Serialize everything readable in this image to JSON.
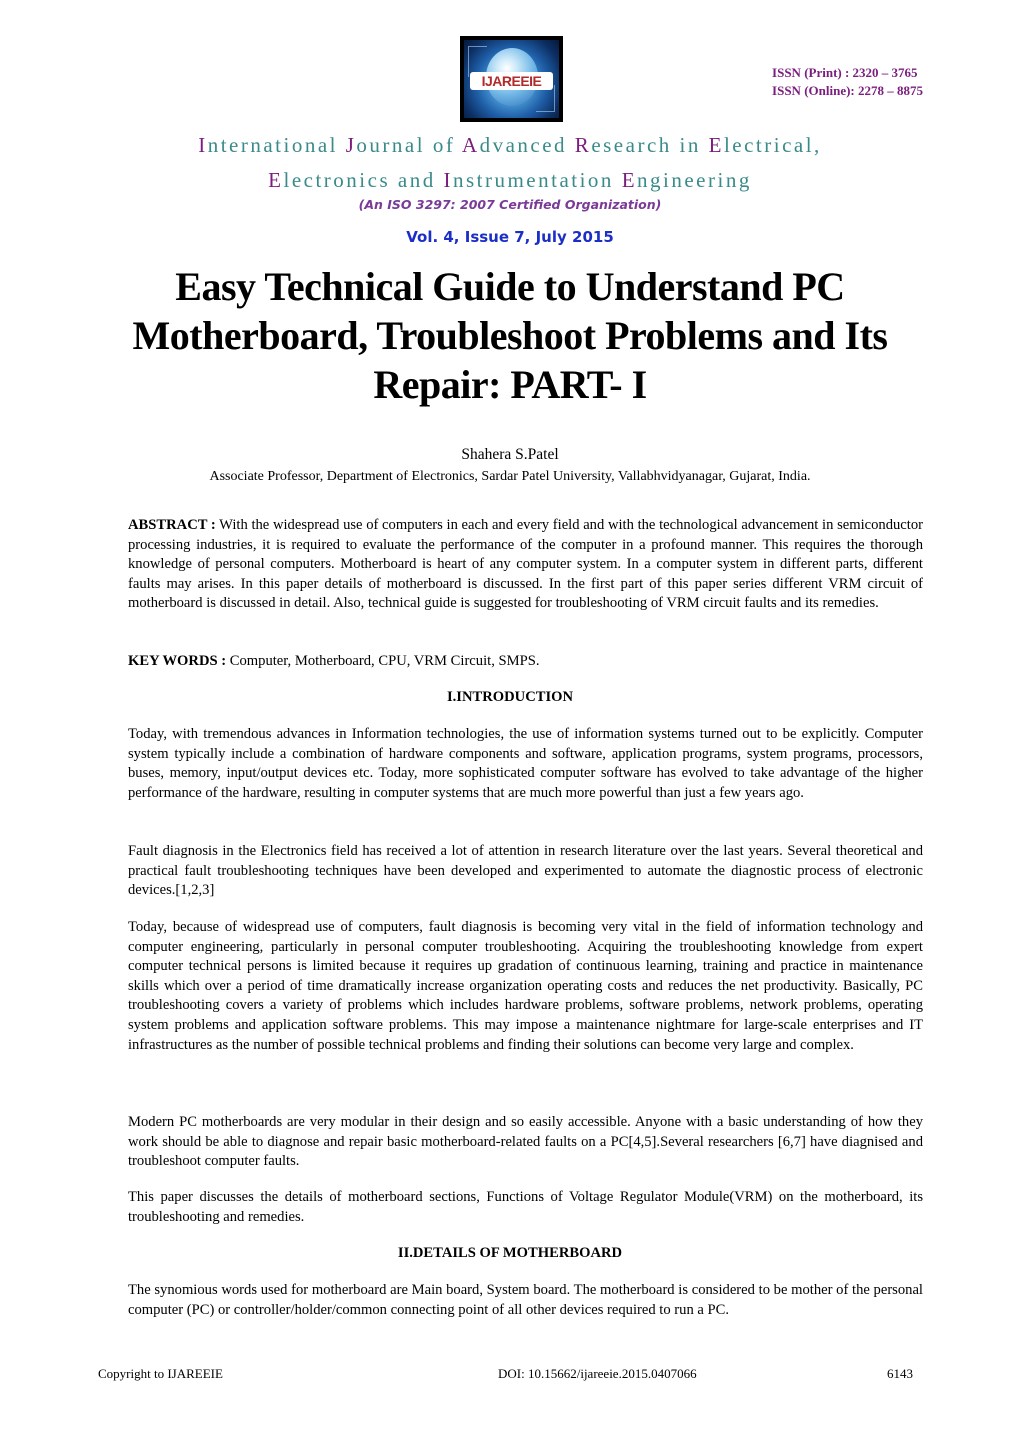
{
  "header": {
    "logo_text": "IJAREEIE",
    "issn_print": "ISSN (Print)  : 2320 – 3765",
    "issn_online": "ISSN (Online): 2278 – 8875",
    "journal_line1": [
      {
        "cap": "I",
        "rest": "nternational "
      },
      {
        "cap": "J",
        "rest": "ournal of "
      },
      {
        "cap": "A",
        "rest": "dvanced "
      },
      {
        "cap": "R",
        "rest": "esearch in  "
      },
      {
        "cap": "E",
        "rest": "lectrical,"
      }
    ],
    "journal_line2": [
      {
        "cap": "E",
        "rest": "lectronics and "
      },
      {
        "cap": "I",
        "rest": "nstrumentation "
      },
      {
        "cap": "E",
        "rest": "ngineering"
      }
    ],
    "iso_note": "(An ISO 3297: 2007 Certified Organization)",
    "volume": "Vol. 4, Issue 7, July 2015",
    "colors": {
      "purple": "#7a1d7e",
      "teal": "#3a8a8a",
      "blue": "#1b2ec8"
    }
  },
  "paper": {
    "title": "Easy Technical Guide to Understand PC Motherboard, Troubleshoot Problems and Its Repair: PART- I",
    "author": "Shahera S.Patel",
    "affiliation": "Associate Professor, Department of Electronics, Sardar Patel University, Vallabhvidyanagar, Gujarat, India.",
    "abstract_label": "ABSTRACT :",
    "abstract_text": " With the widespread use of computers in each and every field and with the technological advancement in semiconductor processing industries, it is required to evaluate the performance of the computer in a profound manner. This requires the thorough knowledge of personal computers. Motherboard is heart of any computer system. In a computer system in different parts, different faults may arises. In this paper details of motherboard is discussed. In the first part of this paper series different VRM circuit of motherboard is discussed in detail. Also, technical guide is suggested for troubleshooting of VRM circuit faults and its remedies.",
    "keywords_label": "KEY WORDS :",
    "keywords_text": " Computer, Motherboard, CPU, VRM Circuit, SMPS.",
    "sections": [
      {
        "heading": "I.INTRODUCTION",
        "paragraphs": [
          "Today, with tremendous advances in Information technologies, the use of information systems  turned out to be explicitly. Computer system typically include a combination of hardware components and software, application programs, system programs, processors, buses, memory, input/output devices etc. Today, more sophisticated computer software has evolved to take advantage of the higher performance of the hardware, resulting in computer systems that are much more powerful than just a few years ago.",
          "Fault diagnosis in the Electronics field has received a lot of attention in research literature over the last years. Several theoretical and practical fault troubleshooting techniques have been developed and experimented to automate the diagnostic process of electronic devices.[1,2,3]",
          "Today, because of widespread use of computers, fault diagnosis is becoming very vital  in the field of information technology and computer engineering, particularly in personal computer troubleshooting. Acquiring the troubleshooting knowledge from expert computer technical persons is limited because it requires up gradation of continuous learning, training and practice in maintenance skills which over a period of time dramatically increase organization operating costs and  reduces the net productivity. Basically, PC troubleshooting covers a variety of problems which includes hardware problems, software problems, network problems, operating system problems and application software problems.  This may impose a maintenance nightmare for large-scale enterprises and IT infrastructures as the number of possible technical problems and finding their solutions can become very large and complex.",
          "Modern PC motherboards are very modular in their design and so easily accessible. Anyone with a  basic understanding of how they work should be able to diagnose and repair basic motherboard-related faults on a PC[4,5].Several researchers [6,7] have diagnised and troubleshoot computer faults.",
          "This paper discusses the details of motherboard sections, Functions of Voltage Regulator Module(VRM) on the motherboard, its troubleshooting and remedies."
        ]
      },
      {
        "heading": "II.DETAILS OF MOTHERBOARD",
        "paragraphs": [
          "The synomious words used for motherboard are Main board, System board. The motherboard is considered to be mother of the personal computer (PC) or controller/holder/common connecting point of all other devices required to run a PC."
        ]
      }
    ]
  },
  "footer": {
    "copyright": "Copyright to IJAREEIE",
    "doi": "DOI: 10.15662/ijareeie.2015.0407066",
    "page_number": "6143"
  }
}
